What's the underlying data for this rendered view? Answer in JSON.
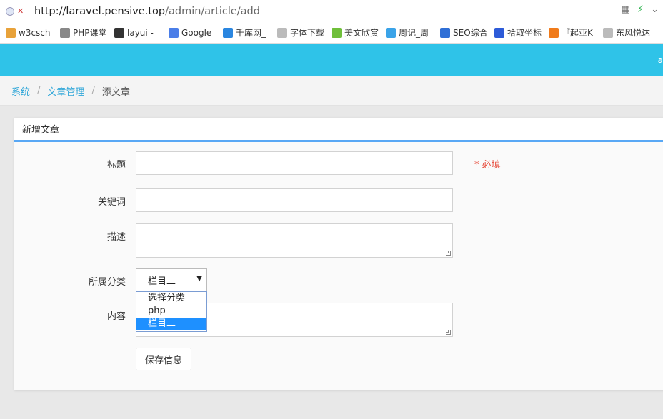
{
  "browser": {
    "url_scheme": "http://",
    "url_host": "laravel.pensive.top",
    "url_path": "/admin/article/add",
    "icons": [
      "security-dot-icon",
      "insecure-icon",
      "qr-icon",
      "bolt-icon",
      "chevron-down-icon"
    ]
  },
  "bookmarks": [
    {
      "label": "w3csch",
      "color": "#e8a23a",
      "icon": "w3c-icon"
    },
    {
      "label": "PHP课堂",
      "color": "#888888",
      "icon": "graduation-cap-icon"
    },
    {
      "label": "layui -",
      "color": "#333333",
      "icon": "layui-icon"
    },
    {
      "label": "Google",
      "color": "#4a7ee8",
      "icon": "google-translate-icon"
    },
    {
      "label": "千库网_",
      "color": "#2a86e0",
      "icon": "qianku-icon"
    },
    {
      "label": "字体下载",
      "color": "#bbbbbb",
      "icon": "page-icon"
    },
    {
      "label": "美文欣赏",
      "color": "#6fbf3a",
      "icon": "leaf-icon"
    },
    {
      "label": "周记_周",
      "color": "#3aa3e8",
      "icon": "heart-icon"
    },
    {
      "label": "SEO综合",
      "color": "#2f6fd6",
      "icon": "seo-icon"
    },
    {
      "label": "拾取坐标",
      "color": "#2d5bd8",
      "icon": "paw-icon"
    },
    {
      "label": "『起亚K",
      "color": "#f07b1b",
      "icon": "maoyun-icon"
    },
    {
      "label": "东风悦达",
      "color": "#bbbbbb",
      "icon": "page-icon"
    }
  ],
  "header": {
    "user_text": "a"
  },
  "breadcrumb": {
    "items": [
      "系统",
      "文章管理",
      "添文章"
    ],
    "separator": "/"
  },
  "panel": {
    "title": "新增文章"
  },
  "form": {
    "title_label": "标题",
    "title_value": "",
    "required_text": "* 必填",
    "keywords_label": "关键词",
    "keywords_value": "",
    "description_label": "描述",
    "description_value": "",
    "category_label": "所属分类",
    "category_selected": "栏目二",
    "category_options": [
      "选择分类",
      "php",
      "栏目二"
    ],
    "content_label": "内容",
    "content_value": "",
    "save_label": "保存信息"
  },
  "colors": {
    "header_bg": "#2fc3e8",
    "accent_line": "#59a8f5",
    "link": "#2ea6d8",
    "required": "#e74c3c",
    "option_selected": "#1e90ff"
  }
}
